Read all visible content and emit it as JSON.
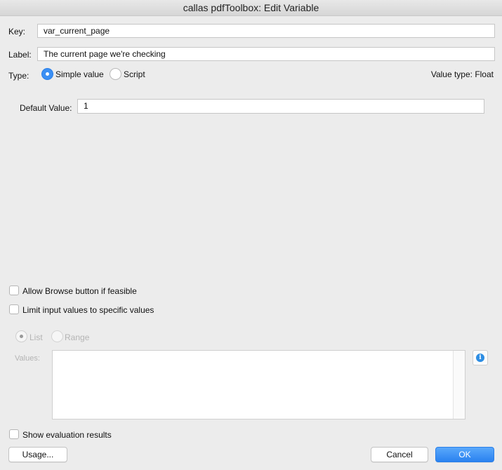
{
  "window": {
    "title": "callas pdfToolbox: Edit Variable"
  },
  "key": {
    "label": "Key:",
    "value": "var_current_page"
  },
  "label_field": {
    "label": "Label:",
    "value": "The current page we're checking"
  },
  "type": {
    "label": "Type:",
    "options": [
      {
        "label": "Simple value",
        "selected": true
      },
      {
        "label": "Script",
        "selected": false
      }
    ],
    "value_type": "Value type: Float"
  },
  "default_value": {
    "label": "Default Value:",
    "value": "1"
  },
  "options": {
    "allow_browse": {
      "label": "Allow Browse button if feasible",
      "checked": false
    },
    "limit_values": {
      "label": "Limit input values to specific values",
      "checked": false
    }
  },
  "limit_mode": {
    "options": [
      {
        "label": "List",
        "selected": true,
        "enabled": false
      },
      {
        "label": "Range",
        "selected": false,
        "enabled": false
      }
    ],
    "values_label": "Values:",
    "values_text": ""
  },
  "show_evaluation": {
    "label": "Show evaluation results",
    "checked": false
  },
  "buttons": {
    "usage": "Usage...",
    "cancel": "Cancel",
    "ok": "OK"
  },
  "colors": {
    "accent": "#3b8ff3",
    "window_bg": "#ececec",
    "info": "#2d8de3"
  }
}
